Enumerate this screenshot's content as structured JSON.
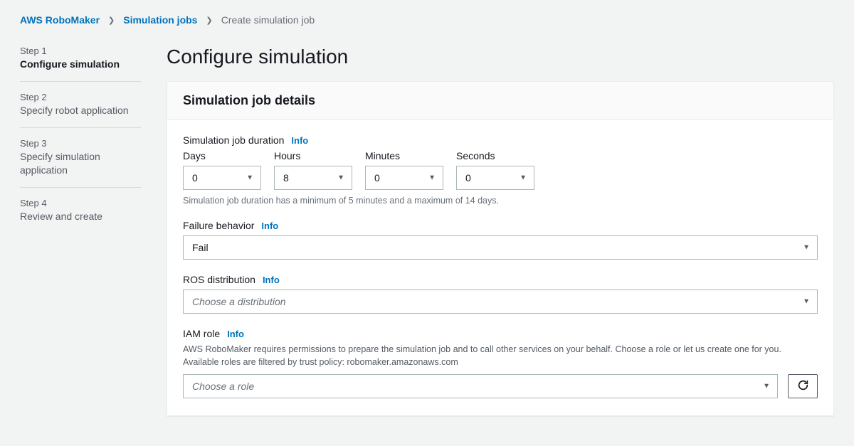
{
  "breadcrumb": {
    "service": "AWS RoboMaker",
    "section": "Simulation jobs",
    "current": "Create simulation job"
  },
  "steps": [
    {
      "num": "Step 1",
      "title": "Configure simulation",
      "active": true
    },
    {
      "num": "Step 2",
      "title": "Specify robot application",
      "active": false
    },
    {
      "num": "Step 3",
      "title": "Specify simulation application",
      "active": false
    },
    {
      "num": "Step 4",
      "title": "Review and create",
      "active": false
    }
  ],
  "page_title": "Configure simulation",
  "panel": {
    "heading": "Simulation job details",
    "duration": {
      "label": "Simulation job duration",
      "info": "Info",
      "units": {
        "days": {
          "label": "Days",
          "value": "0"
        },
        "hours": {
          "label": "Hours",
          "value": "8"
        },
        "minutes": {
          "label": "Minutes",
          "value": "0"
        },
        "seconds": {
          "label": "Seconds",
          "value": "0"
        }
      },
      "hint": "Simulation job duration has a minimum of 5 minutes and a maximum of 14 days."
    },
    "failure": {
      "label": "Failure behavior",
      "info": "Info",
      "value": "Fail"
    },
    "ros": {
      "label": "ROS distribution",
      "info": "Info",
      "placeholder": "Choose a distribution"
    },
    "iam": {
      "label": "IAM role",
      "info": "Info",
      "desc": "AWS RoboMaker requires permissions to prepare the simulation job and to call other services on your behalf. Choose a role or let us create one for you. Available roles are filtered by trust policy: robomaker.amazonaws.com",
      "placeholder": "Choose a role"
    }
  }
}
